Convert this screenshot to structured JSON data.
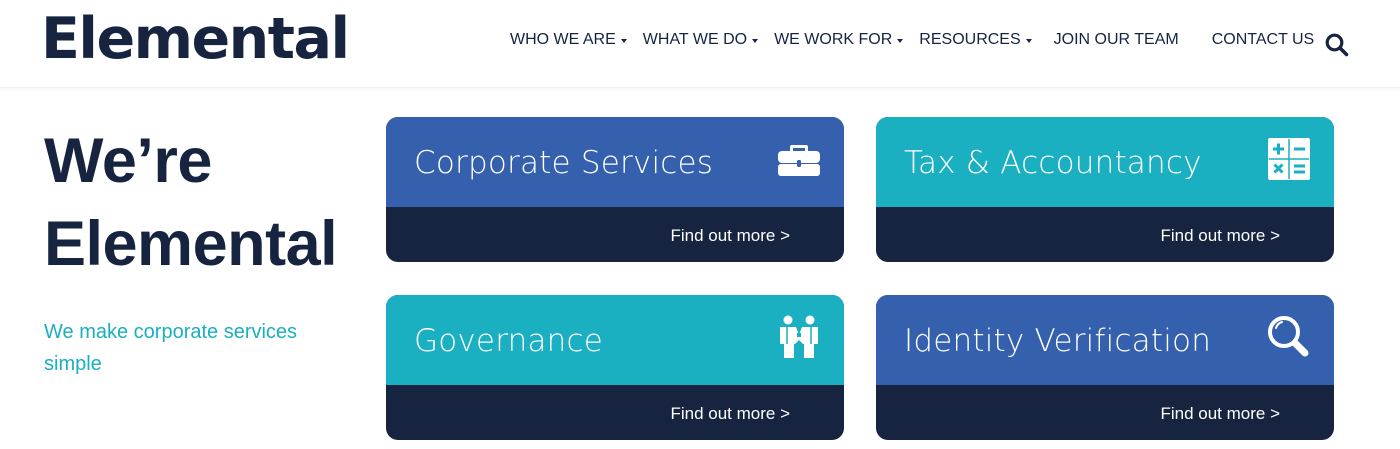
{
  "header": {
    "logo": "Elemental",
    "nav": [
      {
        "label": "WHO WE ARE",
        "has_dropdown": true
      },
      {
        "label": "WHAT WE DO",
        "has_dropdown": true
      },
      {
        "label": "WE WORK FOR",
        "has_dropdown": true
      },
      {
        "label": "RESOURCES",
        "has_dropdown": true
      },
      {
        "label": "JOIN OUR TEAM",
        "has_dropdown": false
      },
      {
        "label": "CONTACT US",
        "has_dropdown": false
      }
    ],
    "search_icon": "search-icon"
  },
  "hero": {
    "title_line1": "We’re",
    "title_line2": "Elemental",
    "tagline": "We make corporate services simple"
  },
  "cards": [
    {
      "title": "Corporate Services",
      "link": "Find out more >",
      "icon": "briefcase-icon",
      "color": "#3560ad"
    },
    {
      "title": "Tax & Accountancy",
      "link": "Find out more >",
      "icon": "calculator-icon",
      "color": "#1aafc1"
    },
    {
      "title": "Governance",
      "link": "Find out more >",
      "icon": "handshake-icon",
      "color": "#1aafc1"
    },
    {
      "title": "Identity Verification",
      "link": "Find out more >",
      "icon": "magnifier-icon",
      "color": "#3560ad"
    }
  ],
  "colors": {
    "navy": "#162440",
    "blue": "#3560ad",
    "teal": "#1aafc1",
    "accent_text": "#1aafc0"
  }
}
